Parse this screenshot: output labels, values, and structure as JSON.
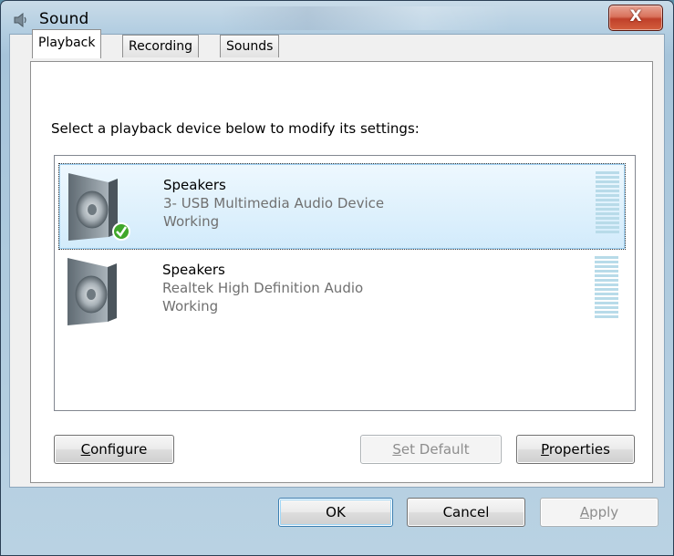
{
  "window": {
    "title": "Sound",
    "close_label": "X"
  },
  "tabs": [
    {
      "label": "Playback"
    },
    {
      "label": "Recording"
    },
    {
      "label": "Sounds"
    }
  ],
  "playback": {
    "instruction": "Select a playback device below to modify its settings:",
    "devices": [
      {
        "name": "Speakers",
        "description": "3- USB Multimedia Audio Device",
        "status": "Working",
        "default": true,
        "selected": true
      },
      {
        "name": "Speakers",
        "description": "Realtek High Definition Audio",
        "status": "Working",
        "default": false,
        "selected": false
      }
    ],
    "configure_label": {
      "accel": "C",
      "rest": "onfigure"
    },
    "set_default_label": {
      "accel": "S",
      "rest": "et Default"
    },
    "properties_label": {
      "accel": "P",
      "rest": "roperties"
    }
  },
  "footer": {
    "ok": "OK",
    "cancel": "Cancel",
    "apply": {
      "accel": "A",
      "rest": "pply"
    }
  },
  "colors": {
    "default_check": "#3fa72a",
    "meter": "#b8dbe9",
    "selection": "#d2ebfb"
  }
}
